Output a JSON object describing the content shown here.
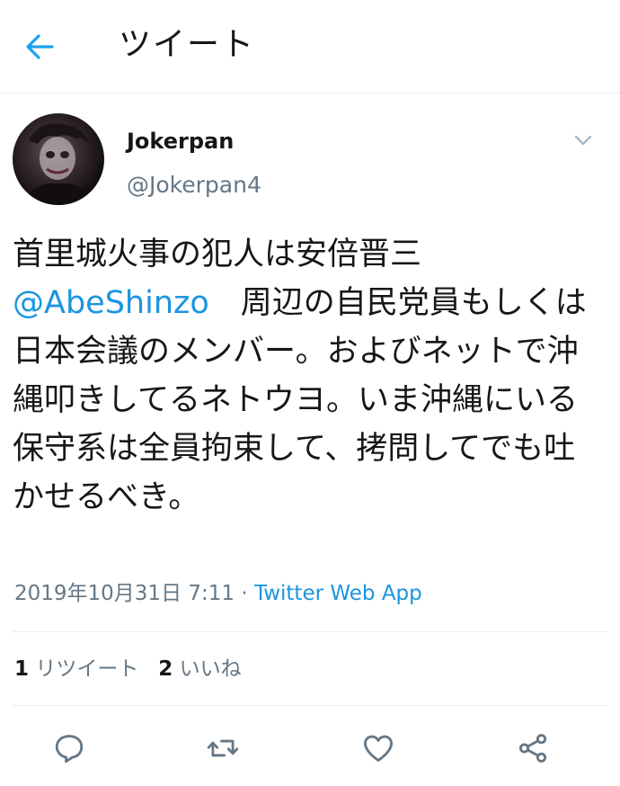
{
  "header": {
    "title": "ツイート",
    "back_icon": "arrow-left-icon",
    "accent": "#1da1f2"
  },
  "tweet": {
    "display_name": "Jokerpan",
    "handle": "@Jokerpan4",
    "text_part1": "首里城火事の犯人は安倍晋三",
    "mention": "@AbeShinzo",
    "text_part2": "　周辺の自民党員もしくは日本会議のメンバー。およびネットで沖縄叩きしてるネトウヨ。いま沖縄にいる保守系は全員拘束して、拷問してでも吐かせるべき。",
    "timestamp": "2019年10月31日 7:11",
    "separator": " · ",
    "source": "Twitter Web App",
    "link_color": "#1b95e0"
  },
  "stats": {
    "retweets_count": "1",
    "retweets_label": "リツイート",
    "likes_count": "2",
    "likes_label": "いいね"
  },
  "actions": {
    "icons": [
      "reply-icon",
      "retweet-icon",
      "like-icon",
      "share-icon"
    ],
    "icon_color": "#657786"
  }
}
